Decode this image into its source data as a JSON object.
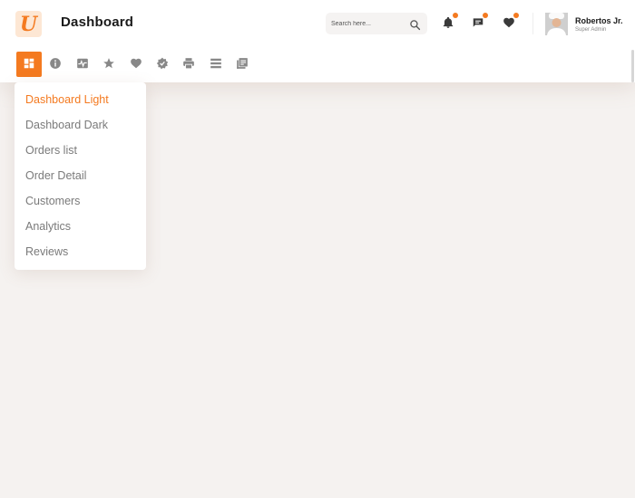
{
  "app": {
    "logo_letter": "U",
    "page_title": "Dashboard"
  },
  "search": {
    "placeholder": "Search here..."
  },
  "user": {
    "name": "Robertos Jr.",
    "role": "Super Admin"
  },
  "notifications": [
    {
      "icon": "bell-icon",
      "has_badge": true
    },
    {
      "icon": "chat-icon",
      "has_badge": true
    },
    {
      "icon": "heart-icon",
      "has_badge": true
    }
  ],
  "nav_icons": [
    "grid-icon",
    "info-icon",
    "activity-icon",
    "star-icon",
    "heart-icon",
    "badge-icon",
    "printer-icon",
    "list-icon",
    "documents-icon"
  ],
  "dropdown": {
    "items": [
      {
        "label": "Dashboard Light",
        "active": true
      },
      {
        "label": "Dashboard Dark",
        "active": false
      },
      {
        "label": "Orders list",
        "active": false
      },
      {
        "label": "Order Detail",
        "active": false
      },
      {
        "label": "Customers",
        "active": false
      },
      {
        "label": "Analytics",
        "active": false
      },
      {
        "label": "Reviews",
        "active": false
      }
    ]
  },
  "colors": {
    "accent": "#f47a20",
    "background": "#f5f2f0",
    "header": "#ffffff",
    "icon": "#888888"
  }
}
